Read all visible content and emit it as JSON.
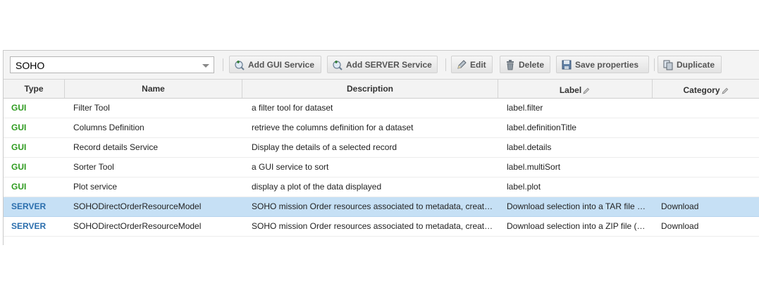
{
  "toolbar": {
    "selector_value": "SOHO",
    "add_gui_label": "Add GUI Service",
    "add_server_label": "Add SERVER Service",
    "edit_label": "Edit",
    "delete_label": "Delete",
    "save_label": "Save properties",
    "duplicate_label": "Duplicate"
  },
  "table": {
    "columns": [
      "Type",
      "Name",
      "Description",
      "Label",
      "Category"
    ],
    "rows": [
      {
        "type": "GUI",
        "name": "Filter Tool",
        "description": "a filter tool for dataset",
        "label": "label.filter",
        "category": ""
      },
      {
        "type": "GUI",
        "name": "Columns Definition",
        "description": "retrieve the columns definition for a dataset",
        "label": "label.definitionTitle",
        "category": ""
      },
      {
        "type": "GUI",
        "name": "Record details Service",
        "description": "Display the details of a selected record",
        "label": "label.details",
        "category": ""
      },
      {
        "type": "GUI",
        "name": "Sorter Tool",
        "description": "a GUI service to sort",
        "label": "label.multiSort",
        "category": ""
      },
      {
        "type": "GUI",
        "name": "Plot service",
        "description": "display a plot of the data displayed",
        "label": "label.plot",
        "category": ""
      },
      {
        "type": "SERVER",
        "name": "SOHODirectOrderResourceModel",
        "description": "SOHO mission Order resources associated to metadata, creat…",
        "label": "Download selection into a TAR file …",
        "category": "Download",
        "selected": true
      },
      {
        "type": "SERVER",
        "name": "SOHODirectOrderResourceModel",
        "description": "SOHO mission Order resources associated to metadata, creat…",
        "label": "Download selection into a ZIP file (…",
        "category": "Download"
      }
    ]
  },
  "colors": {
    "gui_type": "#2e9b1f",
    "server_type": "#2a6ead",
    "selected_row": "#c6e0f5"
  }
}
